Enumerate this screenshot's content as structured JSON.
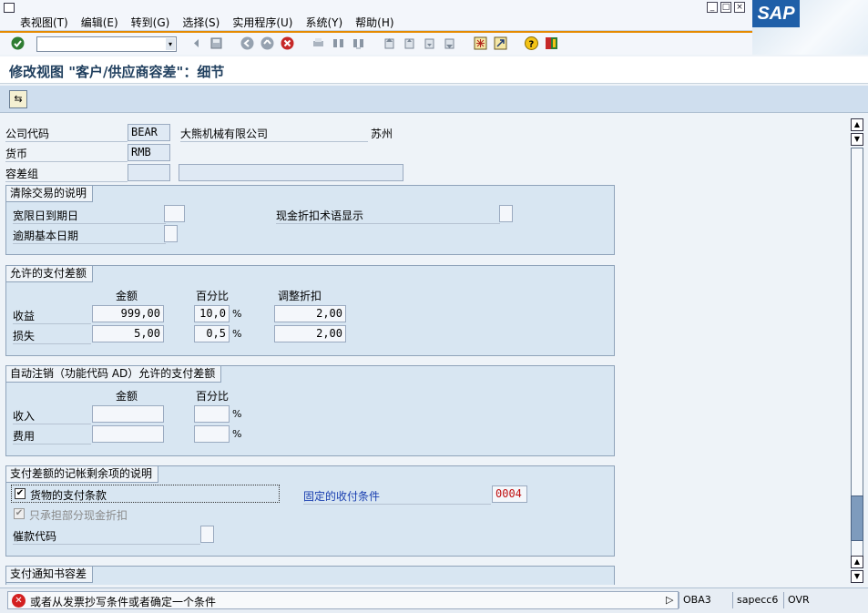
{
  "menubar": {
    "items": [
      "表视图(T)",
      "编辑(E)",
      "转到(G)",
      "选择(S)",
      "实用程序(U)",
      "系统(Y)",
      "帮助(H)"
    ],
    "logo": "SAP"
  },
  "toolbar": {
    "command_value": "",
    "icons": [
      "enter-icon",
      "back-nav-icon",
      "save-icon",
      "back-icon",
      "exit-icon",
      "cancel-icon",
      "print-icon",
      "find-icon",
      "find-next-icon",
      "first-page-icon",
      "prev-page-icon",
      "next-page-icon",
      "last-page-icon",
      "new-session-icon",
      "shortcut-icon",
      "help-icon",
      "layout-icon"
    ]
  },
  "title": "修改视图 \"客户/供应商容差\"：细节",
  "header_fields": {
    "company_code_label": "公司代码",
    "company_code": "BEAR",
    "company_name": "大熊机械有限公司",
    "city": "苏州",
    "currency_label": "货币",
    "currency": "RMB",
    "tolerance_group_label": "容差组",
    "tolerance_group": "",
    "tolerance_group_desc": ""
  },
  "group_clearing": {
    "title": "清除交易的说明",
    "grace_days_label": "宽限日到期日",
    "grace_days": "",
    "cash_disc_label": "现金折扣术语显示",
    "cash_disc": "",
    "arrears_label": "逾期基本日期",
    "arrears": ""
  },
  "group_payment_diff": {
    "title": "允许的支付差额",
    "col_amount": "金额",
    "col_percent": "百分比",
    "col_adjust": "调整折扣",
    "rows": [
      {
        "label": "收益",
        "amount": "999,00",
        "percent": "10,0",
        "adjust": "2,00"
      },
      {
        "label": "损失",
        "amount": "5,00",
        "percent": "0,5",
        "adjust": "2,00"
      }
    ],
    "percent_sign": "%"
  },
  "group_auto_writeoff": {
    "title": "自动注销（功能代码 AD）允许的支付差额",
    "col_amount": "金额",
    "col_percent": "百分比",
    "rows": [
      {
        "label": "收入",
        "amount": "",
        "percent": ""
      },
      {
        "label": "费用",
        "amount": "",
        "percent": ""
      }
    ],
    "percent_sign": "%"
  },
  "group_residual": {
    "title": "支付差额的记帐剩余项的说明",
    "terms_checkbox_label": "货物的支付条款",
    "terms_checked": true,
    "fixed_terms_label": "固定的收付条件",
    "fixed_terms_value": "0004",
    "partial_disc_label": "只承担部分现金折扣",
    "partial_disc_checked": true,
    "dunning_key_label": "催款代码",
    "dunning_key": ""
  },
  "group_advice": {
    "title": "支付通知书容差"
  },
  "statusbar": {
    "message": "或者从发票抄写条件或者确定一个条件",
    "transaction": "OBA3",
    "system": "sapecc6",
    "mode": "OVR"
  },
  "colors": {
    "accent_orange": "#e58a00",
    "title_blue": "#21405f",
    "link_blue": "#1a3fb0",
    "error_red": "#d32020",
    "value_red": "#c01010"
  }
}
